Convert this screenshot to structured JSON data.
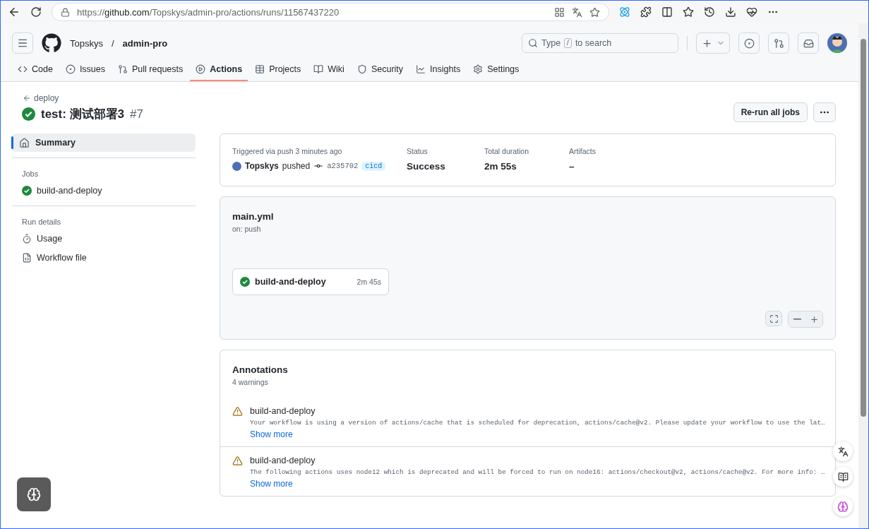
{
  "browser": {
    "url": "https://**github.com**/Topskys/admin-pro/actions/runs/11567437220"
  },
  "header": {
    "owner": "Topskys",
    "separator": "/",
    "repo": "admin-pro",
    "search": {
      "before": "Type",
      "key": "/",
      "after": "to search"
    }
  },
  "tabs": [
    {
      "label": "Code",
      "selected": false
    },
    {
      "label": "Issues",
      "selected": false
    },
    {
      "label": "Pull requests",
      "selected": false
    },
    {
      "label": "Actions",
      "selected": true
    },
    {
      "label": "Projects",
      "selected": false
    },
    {
      "label": "Wiki",
      "selected": false
    },
    {
      "label": "Security",
      "selected": false
    },
    {
      "label": "Insights",
      "selected": false
    },
    {
      "label": "Settings",
      "selected": false
    }
  ],
  "run": {
    "back_link": "deploy",
    "title": "test: 测试部署3",
    "number": "#7",
    "succeeded": true,
    "rerun_button": "Re-run all jobs"
  },
  "sidebar": {
    "summary": {
      "label": "Summary",
      "selected": true
    },
    "sections": [
      {
        "title": "Jobs",
        "items": [
          {
            "kind": "job",
            "label": "build-and-deploy",
            "succeeded": true
          }
        ]
      },
      {
        "title": "Run details",
        "items": [
          {
            "kind": "usage",
            "label": "Usage"
          },
          {
            "kind": "file",
            "label": "Workflow file"
          }
        ]
      }
    ]
  },
  "summary_card": {
    "triggered": "Triggered via push 3 minutes ago",
    "actor": "Topskys",
    "action": "pushed",
    "commit": "a235702",
    "branch": "cicd",
    "stats": [
      {
        "label": "Status",
        "value": "Success"
      },
      {
        "label": "Total duration",
        "value": "2m 55s"
      },
      {
        "label": "Artifacts",
        "value": "–"
      }
    ]
  },
  "workflow": {
    "file": "main.yml",
    "trigger": "on: push",
    "jobs": [
      {
        "name": "build-and-deploy",
        "duration": "2m 45s",
        "succeeded": true
      }
    ]
  },
  "annotations": {
    "title": "Annotations",
    "count": "4 warnings",
    "items": [
      {
        "job": "build-and-deploy",
        "message": "Your workflow is using a version of actions/cache that is scheduled for deprecation, actions/cache@v2. Please update your workflow to use the lat…",
        "link": "Show more"
      },
      {
        "job": "build-and-deploy",
        "message": "The following actions uses node12 which is deprecated and will be forced to run on node16: actions/checkout@v2, actions/cache@v2. For more info: …",
        "link": "Show more"
      }
    ]
  }
}
